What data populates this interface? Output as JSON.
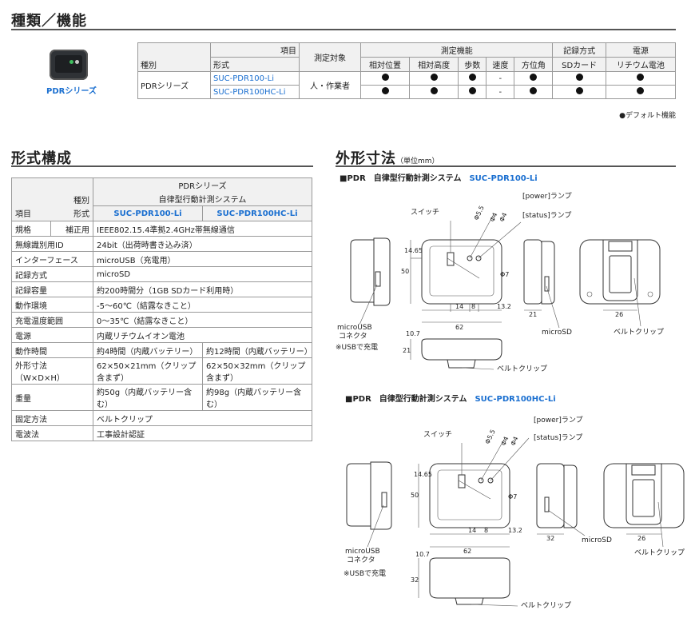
{
  "sec1": {
    "title": "種類／機能"
  },
  "device": {
    "caption": "PDRシリーズ"
  },
  "table1": {
    "h_item": "項目",
    "h_type": "種別",
    "h_model": "形式",
    "h_target": "測定対象",
    "h_func": "測定機能",
    "h_rec": "記録方式",
    "h_power": "電源",
    "func_cols": [
      "相対位置",
      "相対高度",
      "歩数",
      "速度",
      "方位角"
    ],
    "rec_col": "SDカード",
    "power_col": "リチウム電池",
    "series": "PDRシリーズ",
    "target": "人・作業者",
    "rows": [
      {
        "model": "SUC-PDR100-Li",
        "marks": [
          "●",
          "●",
          "●",
          "-",
          "●",
          "●",
          "●"
        ]
      },
      {
        "model": "SUC-PDR100HC-Li",
        "marks": [
          "●",
          "●",
          "●",
          "-",
          "●",
          "●",
          "●"
        ]
      }
    ],
    "note": "●デフォルト機能"
  },
  "sec2": {
    "title": "形式構成"
  },
  "table2": {
    "h_series": "PDRシリーズ",
    "h_system": "自律型行動計測システム",
    "h_type": "種別",
    "h_item": "項目",
    "h_model": "形式",
    "model1": "SUC-PDR100-Li",
    "model2": "SUC-PDR100HC-Li",
    "rows": [
      {
        "label": "規格",
        "sub": "補正用",
        "v1": "IEEE802.15.4準拠2.4GHz帯無線通信"
      },
      {
        "label": "無線識別用ID",
        "v1": "24bit（出荷時書き込み済）"
      },
      {
        "label": "インターフェース",
        "v1": "microUSB（充電用）"
      },
      {
        "label": "記録方式",
        "v1": "microSD"
      },
      {
        "label": "記録容量",
        "v1": "約200時間分（1GB SDカード利用時）"
      },
      {
        "label": "動作環境",
        "v1": "-5～60℃（結露なきこと）"
      },
      {
        "label": "充電温度範囲",
        "v1": "0～35℃（結露なきこと）"
      },
      {
        "label": "電源",
        "v1": "内蔵リチウムイオン電池"
      },
      {
        "label": "動作時間",
        "v1": "約4時間（内蔵バッテリー）",
        "v2": "約12時間（内蔵バッテリー）"
      },
      {
        "label": "外形寸法（W×D×H）",
        "v1": "62×50×21mm（クリップ含まず）",
        "v2": "62×50×32mm（クリップ含まず）"
      },
      {
        "label": "重量",
        "v1": "約50g（内蔵バッテリー含む）",
        "v2": "約98g（内蔵バッテリー含む）"
      },
      {
        "label": "固定方法",
        "v1": "ベルトクリップ"
      },
      {
        "label": "電波法",
        "v1": "工事設計認証"
      }
    ]
  },
  "sec3": {
    "title": "外形寸法",
    "unit": "（単位mm）"
  },
  "drawing1": {
    "heading": "■PDR　自律型行動計測システム",
    "model": "SUC-PDR100-Li",
    "power_lamp": "[power]ランプ",
    "status_lamp": "[status]ランプ",
    "switch": "スイッチ",
    "phi55": "Φ5.5",
    "phi4a": "Φ4",
    "phi4b": "Φ4",
    "phi7": "Φ7",
    "d1465": "14.65",
    "d50": "50",
    "d14": "14",
    "d8": "8",
    "d132": "13.2",
    "d62": "62",
    "d21": "21",
    "d26": "26",
    "d107": "10.7",
    "d21b": "21",
    "usb1": "microUSB",
    "usb2": "コネクタ",
    "usb_note": "※USBで充電",
    "microsd": "microSD",
    "belt": "ベルトクリップ",
    "belt2": "ベルトクリップ"
  },
  "drawing2": {
    "heading": "■PDR　自律型行動計測システム",
    "model": "SUC-PDR100HC-Li",
    "power_lamp": "[power]ランプ",
    "status_lamp": "[status]ランプ",
    "switch": "スイッチ",
    "phi55": "Φ5.5",
    "phi4a": "Φ4",
    "phi4b": "Φ4",
    "phi7": "Φ7",
    "d1465": "14.65",
    "d50": "50",
    "d14": "14",
    "d8": "8",
    "d132": "13.2",
    "d62": "62",
    "d32": "32",
    "d26": "26",
    "d107": "10.7",
    "d32b": "32",
    "usb1": "microUSB",
    "usb2": "コネクタ",
    "usb_note": "※USBで充電",
    "microsd": "microSD",
    "belt": "ベルトクリップ",
    "belt2": "ベルトクリップ"
  }
}
